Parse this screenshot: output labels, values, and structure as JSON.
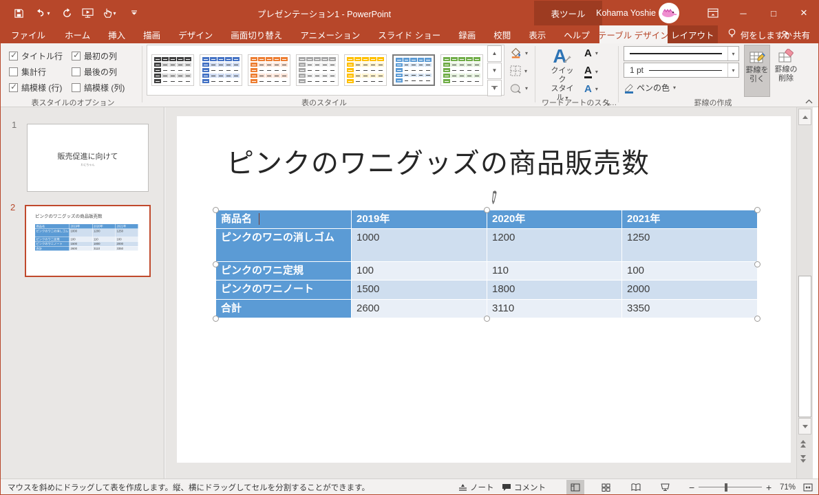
{
  "titlebar": {
    "title": "プレゼンテーション1 - PowerPoint",
    "contextual_tool": "表ツール",
    "user_name": "Kohama Yoshie"
  },
  "tabs": {
    "file": "ファイル",
    "items": [
      "ホーム",
      "挿入",
      "描画",
      "デザイン",
      "画面切り替え",
      "アニメーション",
      "スライド ショー",
      "録画",
      "校閲",
      "表示",
      "ヘルプ"
    ],
    "contextual_active": "テーブル デザイン",
    "contextual_second": "レイアウト",
    "tell_me": "何をしますか",
    "share": "共有"
  },
  "ribbon": {
    "style_options": {
      "label": "表スタイルのオプション",
      "options": [
        {
          "label": "タイトル行",
          "checked": true
        },
        {
          "label": "集計行",
          "checked": false
        },
        {
          "label": "縞模様 (行)",
          "checked": true
        },
        {
          "label": "最初の列",
          "checked": true
        },
        {
          "label": "最後の列",
          "checked": false
        },
        {
          "label": "縞模様 (列)",
          "checked": false
        }
      ]
    },
    "table_styles": {
      "label": "表のスタイル",
      "items": [
        {
          "name": "dark-style-black",
          "color": "#3f3f3f",
          "band": "#d9d9d9",
          "selected": false
        },
        {
          "name": "medium-style-blue-dark",
          "color": "#4472c4",
          "band": "#cdd9f0",
          "selected": false
        },
        {
          "name": "medium-style-orange",
          "color": "#ed7d31",
          "band": "#fbe2d5",
          "selected": false
        },
        {
          "name": "medium-style-gray",
          "color": "#a6a6a6",
          "band": "#ededed",
          "selected": false
        },
        {
          "name": "medium-style-gold",
          "color": "#ffc000",
          "band": "#fff2cc",
          "selected": false
        },
        {
          "name": "medium-style-blue",
          "color": "#5b9bd5",
          "band": "#d6e4f3",
          "selected": true
        },
        {
          "name": "medium-style-green",
          "color": "#70ad47",
          "band": "#e2efda",
          "selected": false
        }
      ]
    },
    "wordart": {
      "label": "ワードアートのスタ…",
      "quick_style_1": "クイック",
      "quick_style_2": "スタイル"
    },
    "borders": {
      "label": "罫線の作成",
      "pen_weight": "1 pt",
      "pen_color": "ペンの色",
      "draw_1": "罫線を",
      "draw_2": "引く",
      "erase_1": "罫線の",
      "erase_2": "削除"
    }
  },
  "slides_panel": [
    {
      "num": "1",
      "title": "販売促進に向けて",
      "subtitle": "わにちゃん"
    },
    {
      "num": "2",
      "title": "ピンクのワニグッズの商品販売数",
      "selected": true
    }
  ],
  "slide": {
    "title": "ピンクのワニグッズの商品販売数",
    "table": {
      "headers": [
        "商品名",
        "2019年",
        "2020年",
        "2021年"
      ],
      "rows": [
        {
          "name": "ピンクのワニの消しゴム",
          "values": [
            "1000",
            "1200",
            "1250"
          ]
        },
        {
          "name": "ピンクのワニ定規",
          "values": [
            "100",
            "110",
            "100"
          ]
        },
        {
          "name": "ピンクのワニノート",
          "values": [
            "1500",
            "1800",
            "2000"
          ]
        },
        {
          "name": "合計",
          "values": [
            "2600",
            "3110",
            "3350"
          ]
        }
      ],
      "colors": {
        "header": "#5b9bd5",
        "band_dark": "#cfdeef",
        "band_light": "#e9eff7"
      }
    }
  },
  "status": {
    "message": "マウスを斜めにドラッグして表を作成します。縦、横にドラッグしてセルを分割することができます。",
    "notes": "ノート",
    "comments": "コメント",
    "zoom": "71%"
  },
  "colors": {
    "accent": "#b7472a",
    "contextual_dark": "#9d3b21",
    "ribbon_bg": "#f3f1f0"
  }
}
